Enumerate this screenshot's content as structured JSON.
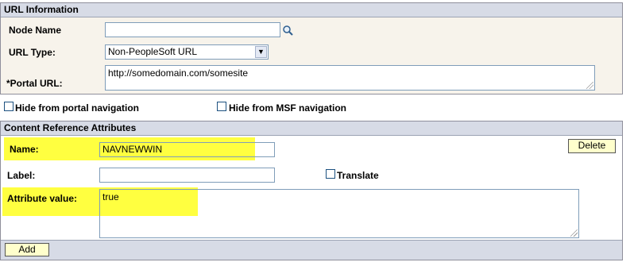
{
  "url_info": {
    "header": "URL Information",
    "node_name_label": "Node Name",
    "node_name_value": "",
    "url_type_label": "URL Type:",
    "url_type_value": "Non-PeopleSoft URL",
    "portal_url_label": "*Portal URL:",
    "portal_url_value": "http://somedomain.com/somesite"
  },
  "options": {
    "hide_portal_label": "Hide from portal navigation",
    "hide_msf_label": "Hide from MSF navigation"
  },
  "cra": {
    "header": "Content Reference Attributes",
    "name_label": "Name:",
    "name_value": "NAVNEWWIN",
    "delete_label": "Delete",
    "label_label": "Label:",
    "label_value": "",
    "translate_label": "Translate",
    "attr_value_label": "Attribute value:",
    "attr_value": "true",
    "add_label": "Add"
  },
  "colors": {
    "highlight": "#ffff40",
    "section_header": "#d7dbe6",
    "url_section_bg": "#f7f3eb",
    "button_bg": "#ffffcc"
  }
}
